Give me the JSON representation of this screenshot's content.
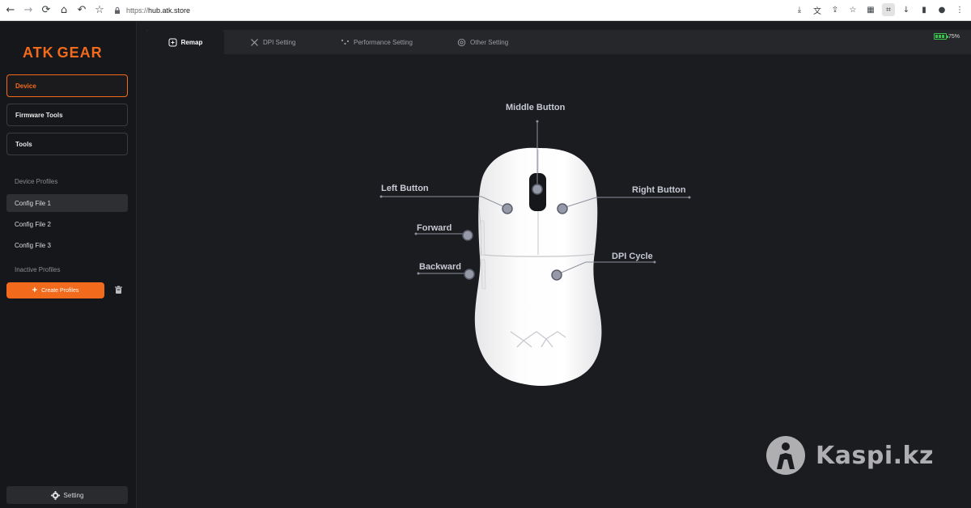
{
  "browser": {
    "url_scheme": "https://",
    "url_host": "hub.atk.store"
  },
  "brand": {
    "part1": "ATK",
    "part2": "GEAR"
  },
  "sidebar": {
    "nav": [
      {
        "label": "Device",
        "active": true
      },
      {
        "label": "Firmware Tools",
        "active": false
      },
      {
        "label": "Tools",
        "active": false
      }
    ],
    "device_profiles_label": "Device Profiles",
    "configs": [
      {
        "label": "Config File 1",
        "selected": true
      },
      {
        "label": "Config File 2",
        "selected": false
      },
      {
        "label": "Config File 3",
        "selected": false
      }
    ],
    "inactive_profiles_label": "Inactive Profiles",
    "create_label": "Create Profiles",
    "setting_label": "Setting"
  },
  "tabs": [
    {
      "label": "Remap",
      "icon": "remap-icon",
      "active": true
    },
    {
      "label": "DPI Setting",
      "icon": "dpi-icon",
      "active": false
    },
    {
      "label": "Performance Setting",
      "icon": "performance-icon",
      "active": false
    },
    {
      "label": "Other Setting",
      "icon": "other-setting-icon",
      "active": false
    }
  ],
  "battery": {
    "percent_label": "75%"
  },
  "buttons": {
    "middle": "Middle Button",
    "left": "Left Button",
    "right": "Right Button",
    "forward": "Forward",
    "backward": "Backward",
    "dpi": "DPI Cycle"
  },
  "watermark": "Kaspi.kz",
  "colors": {
    "accent": "#f26a1b",
    "bg": "#1b1c20",
    "sidebar": "#16171a",
    "battery": "#36c24c"
  }
}
